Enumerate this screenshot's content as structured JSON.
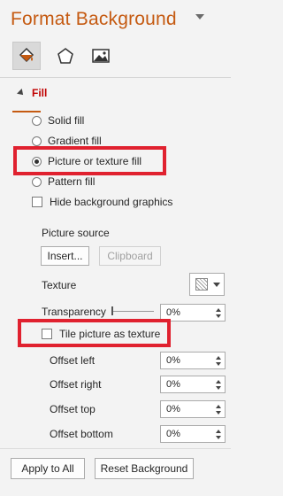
{
  "pane": {
    "title": "Format Background",
    "tabs": [
      {
        "name": "fill-tab",
        "icon": "paint-bucket-icon",
        "active": true
      },
      {
        "name": "effects-tab",
        "icon": "pentagon-icon",
        "active": false
      },
      {
        "name": "picture-tab",
        "icon": "picture-icon",
        "active": false
      }
    ],
    "accent_color": "#c55a11"
  },
  "fill": {
    "section_title": "Fill",
    "options": {
      "solid": "Solid fill",
      "gradient": "Gradient fill",
      "picture": "Picture or texture fill",
      "pattern": "Pattern fill"
    },
    "selected": "Picture or texture fill",
    "hide_background_graphics": "Hide background graphics",
    "picture_source_label": "Picture source",
    "insert_button": "Insert...",
    "clipboard_button": "Clipboard",
    "texture_label": "Texture",
    "transparency_label": "Transparency",
    "transparency_value": "0%",
    "tile_label": "Tile picture as texture",
    "offsets": {
      "left_label": "Offset left",
      "left_value": "0%",
      "right_label": "Offset right",
      "right_value": "0%",
      "top_label": "Offset top",
      "top_value": "0%",
      "bottom_label": "Offset bottom",
      "bottom_value": "0%"
    }
  },
  "footer": {
    "apply_all": "Apply to All",
    "reset": "Reset Background"
  },
  "highlight_color": "#e0212f"
}
